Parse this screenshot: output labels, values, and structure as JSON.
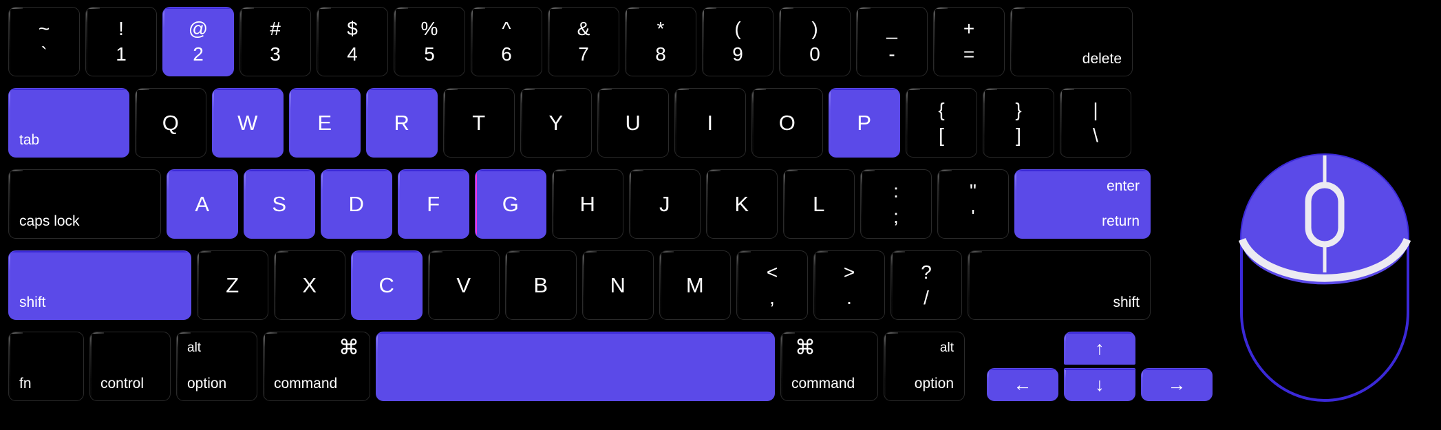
{
  "meta": {
    "accent_color": "#5b4ae8",
    "edge_marker_color": "#ff2fd6",
    "background_color": "#000000",
    "key_text_color": "#ffffff"
  },
  "keyboard": {
    "rows": [
      {
        "name": "number-row",
        "keys": [
          {
            "id": "backtick",
            "top": "~",
            "bottom": "`",
            "style": "dual",
            "highlight": false
          },
          {
            "id": "one",
            "top": "!",
            "bottom": "1",
            "style": "dual",
            "highlight": false
          },
          {
            "id": "two",
            "top": "@",
            "bottom": "2",
            "style": "dual",
            "highlight": true
          },
          {
            "id": "three",
            "top": "#",
            "bottom": "3",
            "style": "dual",
            "highlight": false
          },
          {
            "id": "four",
            "top": "$",
            "bottom": "4",
            "style": "dual",
            "highlight": false
          },
          {
            "id": "five",
            "top": "%",
            "bottom": "5",
            "style": "dual",
            "highlight": false
          },
          {
            "id": "six",
            "top": "^",
            "bottom": "6",
            "style": "dual",
            "highlight": false
          },
          {
            "id": "seven",
            "top": "&",
            "bottom": "7",
            "style": "dual",
            "highlight": false
          },
          {
            "id": "eight",
            "top": "*",
            "bottom": "8",
            "style": "dual",
            "highlight": false
          },
          {
            "id": "nine",
            "top": "(",
            "bottom": "9",
            "style": "dual",
            "highlight": false
          },
          {
            "id": "zero",
            "top": ")",
            "bottom": "0",
            "style": "dual",
            "highlight": false
          },
          {
            "id": "minus",
            "top": "_",
            "bottom": "-",
            "style": "dual",
            "highlight": false
          },
          {
            "id": "equal",
            "top": "+",
            "bottom": "=",
            "style": "dual",
            "highlight": false
          },
          {
            "id": "delete",
            "label": "delete",
            "style": "bottom-right",
            "highlight": false
          }
        ]
      },
      {
        "name": "qwerty-row",
        "keys": [
          {
            "id": "tab",
            "label": "tab",
            "style": "bottom-left",
            "highlight": true
          },
          {
            "id": "q",
            "label": "Q",
            "style": "center",
            "highlight": false
          },
          {
            "id": "w",
            "label": "W",
            "style": "center",
            "highlight": true
          },
          {
            "id": "e",
            "label": "E",
            "style": "center",
            "highlight": true
          },
          {
            "id": "r",
            "label": "R",
            "style": "center",
            "highlight": true
          },
          {
            "id": "t",
            "label": "T",
            "style": "center",
            "highlight": false
          },
          {
            "id": "y",
            "label": "Y",
            "style": "center",
            "highlight": false
          },
          {
            "id": "u",
            "label": "U",
            "style": "center",
            "highlight": false
          },
          {
            "id": "i",
            "label": "I",
            "style": "center",
            "highlight": false
          },
          {
            "id": "o",
            "label": "O",
            "style": "center",
            "highlight": false
          },
          {
            "id": "p",
            "label": "P",
            "style": "center",
            "highlight": true
          },
          {
            "id": "bracket-left",
            "top": "{",
            "bottom": "[",
            "style": "dual",
            "highlight": false
          },
          {
            "id": "bracket-right",
            "top": "}",
            "bottom": "]",
            "style": "dual",
            "highlight": false
          },
          {
            "id": "backslash",
            "top": "|",
            "bottom": "\\",
            "style": "dual",
            "highlight": false
          }
        ]
      },
      {
        "name": "home-row",
        "keys": [
          {
            "id": "caps-lock",
            "label": "caps lock",
            "style": "bottom-left",
            "highlight": false
          },
          {
            "id": "a",
            "label": "A",
            "style": "center",
            "highlight": true
          },
          {
            "id": "s",
            "label": "S",
            "style": "center",
            "highlight": true
          },
          {
            "id": "d",
            "label": "D",
            "style": "center",
            "highlight": true
          },
          {
            "id": "f",
            "label": "F",
            "style": "center",
            "highlight": true
          },
          {
            "id": "g",
            "label": "G",
            "style": "center",
            "highlight": true,
            "edge_marker": true
          },
          {
            "id": "h",
            "label": "H",
            "style": "center",
            "highlight": false
          },
          {
            "id": "j",
            "label": "J",
            "style": "center",
            "highlight": false
          },
          {
            "id": "k",
            "label": "K",
            "style": "center",
            "highlight": false
          },
          {
            "id": "l",
            "label": "L",
            "style": "center",
            "highlight": false
          },
          {
            "id": "semicolon",
            "top": ":",
            "bottom": ";",
            "style": "dual",
            "highlight": false
          },
          {
            "id": "quote",
            "top": "\"",
            "bottom": "'",
            "style": "dual",
            "highlight": false
          },
          {
            "id": "return",
            "label": "enter",
            "label2": "return",
            "style": "enter",
            "highlight": true
          }
        ]
      },
      {
        "name": "shift-row",
        "keys": [
          {
            "id": "shift-left",
            "label": "shift",
            "style": "bottom-left",
            "highlight": true
          },
          {
            "id": "z",
            "label": "Z",
            "style": "center",
            "highlight": false
          },
          {
            "id": "x",
            "label": "X",
            "style": "center",
            "highlight": false
          },
          {
            "id": "c",
            "label": "C",
            "style": "center",
            "highlight": true
          },
          {
            "id": "v",
            "label": "V",
            "style": "center",
            "highlight": false
          },
          {
            "id": "b",
            "label": "B",
            "style": "center",
            "highlight": false
          },
          {
            "id": "n",
            "label": "N",
            "style": "center",
            "highlight": false
          },
          {
            "id": "m",
            "label": "M",
            "style": "center",
            "highlight": false
          },
          {
            "id": "comma",
            "top": "<",
            "bottom": ",",
            "style": "dual",
            "highlight": false
          },
          {
            "id": "period",
            "top": ">",
            "bottom": ".",
            "style": "dual",
            "highlight": false
          },
          {
            "id": "slash",
            "top": "?",
            "bottom": "/",
            "style": "dual",
            "highlight": false
          },
          {
            "id": "shift-right",
            "label": "shift",
            "style": "bottom-right",
            "highlight": false
          }
        ]
      },
      {
        "name": "bottom-row",
        "keys": [
          {
            "id": "fn",
            "label": "fn",
            "style": "bottom-left",
            "highlight": false
          },
          {
            "id": "control",
            "label": "control",
            "style": "bottom-left",
            "highlight": false
          },
          {
            "id": "option-left",
            "label": "option",
            "label2": "alt",
            "style": "mod-left",
            "highlight": false
          },
          {
            "id": "command-left",
            "label": "command",
            "label2": "⌘",
            "style": "cmd-left",
            "highlight": false
          },
          {
            "id": "space",
            "label": "",
            "style": "center",
            "highlight": true
          },
          {
            "id": "command-right",
            "label": "command",
            "label2": "⌘",
            "style": "cmd-left",
            "highlight": false
          },
          {
            "id": "option-right",
            "label": "option",
            "label2": "alt",
            "style": "mod-right",
            "highlight": false
          },
          {
            "id": "arrow-left",
            "label": "←",
            "style": "arrow",
            "highlight": true
          },
          {
            "id": "arrow-up",
            "label": "↑",
            "style": "arrow",
            "highlight": true
          },
          {
            "id": "arrow-down",
            "label": "↓",
            "style": "arrow",
            "highlight": true
          },
          {
            "id": "arrow-right",
            "label": "→",
            "style": "arrow",
            "highlight": true
          }
        ]
      }
    ]
  },
  "mouse": {
    "name": "computer-mouse",
    "highlight_region": "top-buttons-and-scroll-wheel",
    "left_button_highlighted": true,
    "right_button_highlighted": true,
    "scroll_wheel_highlighted": true,
    "body_highlighted": false
  }
}
